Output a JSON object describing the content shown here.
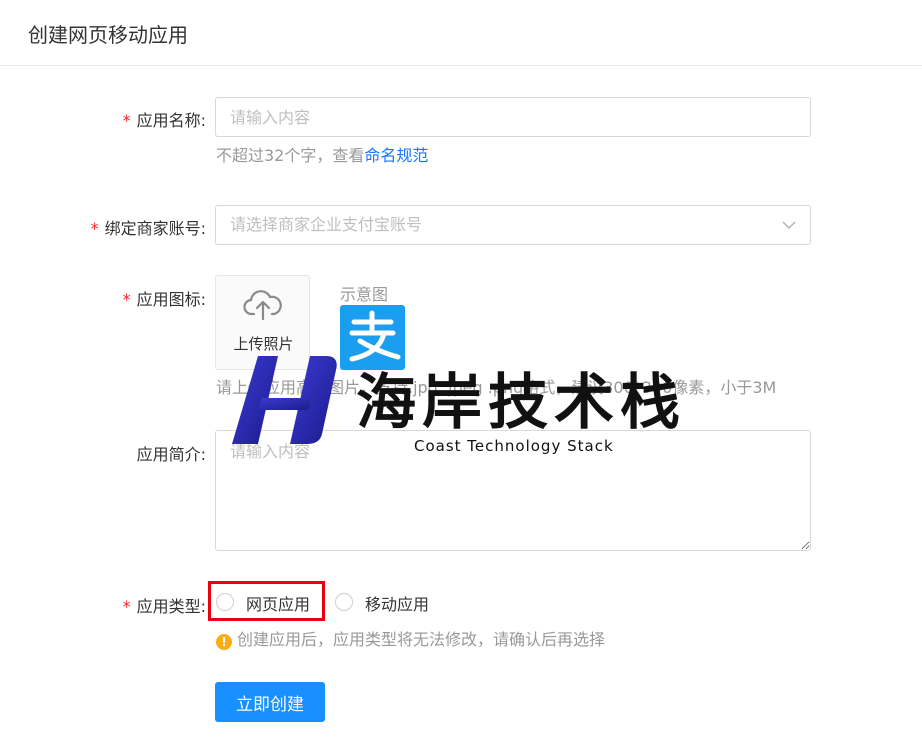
{
  "header": {
    "title": "创建网页移动应用"
  },
  "form": {
    "name": {
      "label": "应用名称:",
      "placeholder": "请输入内容",
      "hint_prefix": "不超过32个字，查看",
      "hint_link": "命名规范"
    },
    "account": {
      "label": "绑定商家账号:",
      "placeholder": "请选择商家企业支付宝账号"
    },
    "icon": {
      "label": "应用图标:",
      "upload_label": "上传照片",
      "example_label": "示意图",
      "hint": "请上传应用高清图片，支持.jpg .jpeg .png格式，建议300*300像素，小于3M"
    },
    "intro": {
      "label": "应用简介:",
      "placeholder": "请输入内容"
    },
    "type": {
      "label": "应用类型:",
      "options": [
        "网页应用",
        "移动应用"
      ],
      "warning": "创建应用后，应用类型将无法修改，请确认后再选择"
    },
    "submit_label": "立即创建"
  },
  "watermark": {
    "brand": "海岸技术栈",
    "subtitle": "Coast Technology Stack"
  },
  "colors": {
    "primary": "#1890ff",
    "required": "#f5222d",
    "highlight": "#e60012",
    "warning": "#faad14",
    "alipay": "#1a9ef0"
  }
}
